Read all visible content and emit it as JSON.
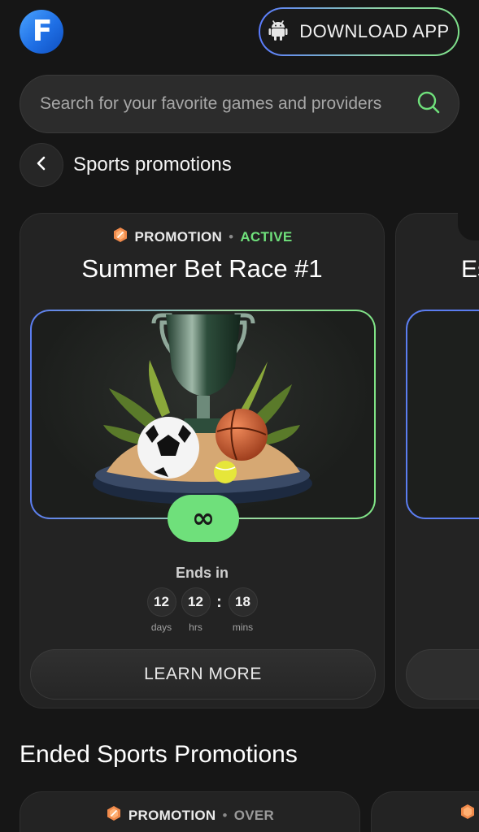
{
  "header": {
    "logo_letter": "F",
    "download_label": "DOWNLOAD APP"
  },
  "search": {
    "placeholder": "Search for your favorite games and providers"
  },
  "breadcrumb": {
    "title": "Sports promotions"
  },
  "active_promotion": {
    "type": "PROMOTION",
    "separator": "•",
    "status": "ACTIVE",
    "title": "Summer Bet Race #1",
    "badge": "∞",
    "ends_label": "Ends in",
    "countdown": {
      "days": "12",
      "days_caption": "days",
      "hours": "12",
      "hours_caption": "hrs",
      "separator": ":",
      "mins": "18",
      "mins_caption": "mins"
    },
    "button_label": "LEARN MORE"
  },
  "next_promotion_peek": {
    "title_fragment": "Es"
  },
  "ended_section": {
    "title": "Ended Sports Promotions",
    "first": {
      "type": "PROMOTION",
      "separator": "•",
      "status": "OVER"
    }
  },
  "colors": {
    "accent_green": "#6fe07b",
    "accent_blue": "#5b7df0",
    "brand_blue": "#1f6fe5",
    "background": "#161616"
  }
}
